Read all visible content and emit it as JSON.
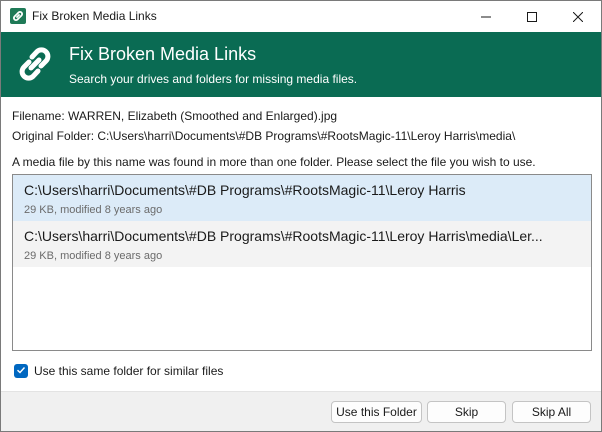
{
  "window": {
    "title": "Fix Broken Media Links"
  },
  "banner": {
    "title": "Fix Broken Media Links",
    "subtitle": "Search your drives and folders for missing media files."
  },
  "info": {
    "filename": "Filename: WARREN, Elizabeth (Smoothed and Enlarged).jpg",
    "original_folder": "Original Folder: C:\\Users\\harri\\Documents\\#DB Programs\\#RootsMagic-11\\Leroy Harris\\media\\",
    "instruction": "A media file by this name was found in more than one folder. Please select the file you wish to use."
  },
  "results": [
    {
      "path": "C:\\Users\\harri\\Documents\\#DB Programs\\#RootsMagic-11\\Leroy Harris",
      "meta": "29 KB, modified 8 years ago",
      "selected": true
    },
    {
      "path": "C:\\Users\\harri\\Documents\\#DB Programs\\#RootsMagic-11\\Leroy Harris\\media\\Ler...",
      "meta": "29 KB, modified 8 years ago",
      "selected": false
    }
  ],
  "options": {
    "same_folder_label": "Use this same folder for similar files",
    "same_folder_checked": true
  },
  "buttons": {
    "use_folder": "Use this Folder",
    "skip": "Skip",
    "skip_all": "Skip All"
  },
  "colors": {
    "banner": "#0a6b53",
    "selection": "#dcebf8",
    "checkbox_accent": "#0067c0"
  },
  "icons": {
    "app": "chain-link-icon",
    "banner": "chain-link-icon",
    "minimize": "minimize-icon",
    "maximize": "maximize-icon",
    "close": "close-icon",
    "checkmark": "checkmark-icon"
  }
}
